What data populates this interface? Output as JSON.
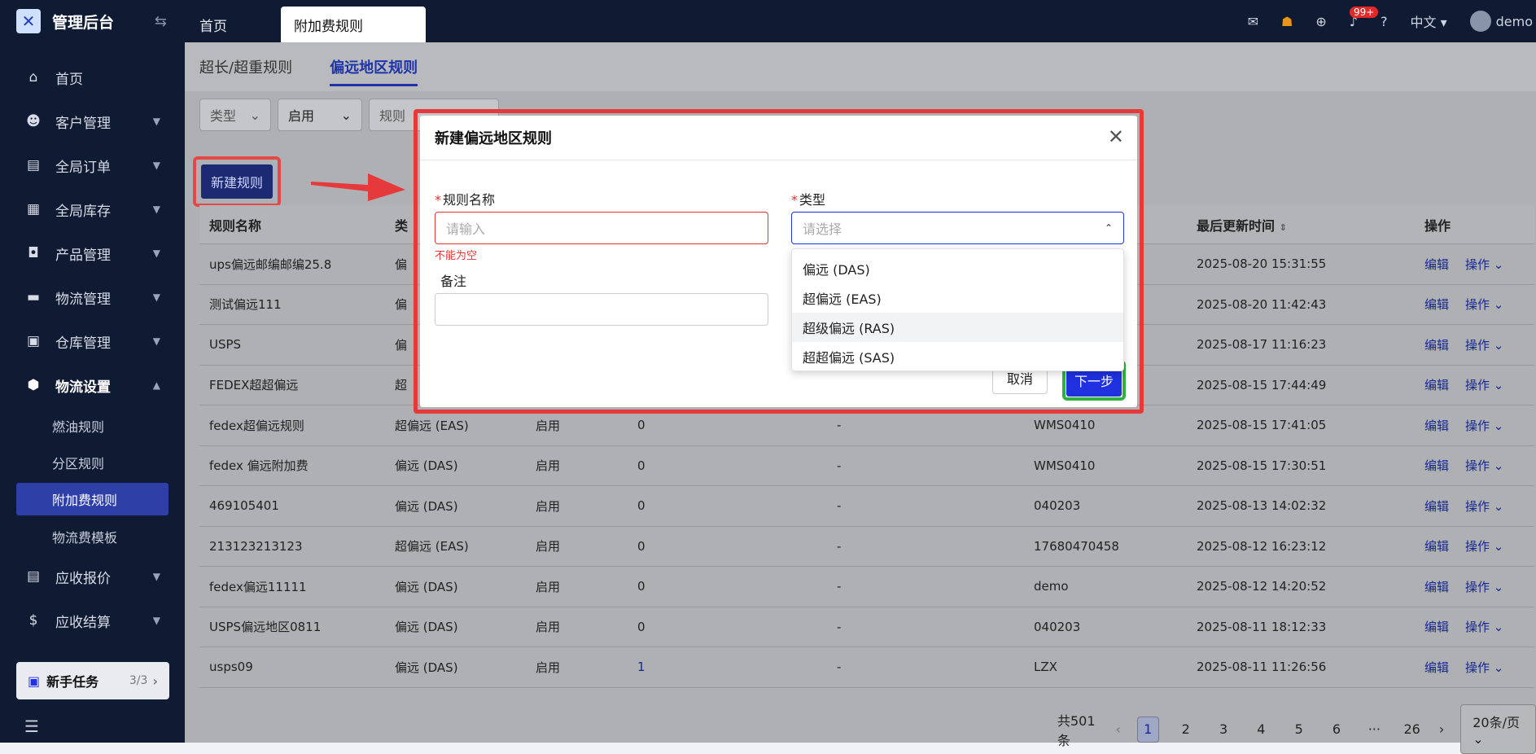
{
  "app": {
    "title": "管理后台"
  },
  "sidebar": {
    "items": [
      {
        "label": "首页"
      },
      {
        "label": "客户管理"
      },
      {
        "label": "全局订单"
      },
      {
        "label": "全局库存"
      },
      {
        "label": "产品管理"
      },
      {
        "label": "物流管理"
      },
      {
        "label": "仓库管理"
      },
      {
        "label": "物流设置"
      }
    ],
    "subitems": [
      {
        "label": "燃油规则"
      },
      {
        "label": "分区规则"
      },
      {
        "label": "附加费规则"
      },
      {
        "label": "物流费模板"
      }
    ],
    "items_after": [
      {
        "label": "应收报价"
      },
      {
        "label": "应收结算"
      }
    ],
    "task": {
      "label": "新手任务",
      "count": "3/3"
    }
  },
  "topbar": {
    "tabs": [
      {
        "label": "首页"
      },
      {
        "label": "附加费规则"
      }
    ],
    "badge": "99+",
    "lang": "中文",
    "user": "demo"
  },
  "subtabs": [
    {
      "label": "超长/超重规则"
    },
    {
      "label": "偏远地区规则"
    }
  ],
  "filters": {
    "type": "类型",
    "status": "启用",
    "name_placeholder": "规则"
  },
  "new_button": "新建规则",
  "table": {
    "headers": [
      "规则名称",
      "类",
      "",
      "",
      "",
      "",
      "最后更新时间",
      "操作"
    ],
    "rows": [
      [
        "ups偏远邮编邮编25.8",
        "偏",
        "",
        "",
        "",
        "",
        "2025-08-20 15:31:55"
      ],
      [
        "测试偏远111",
        "偏",
        "",
        "",
        "",
        "",
        "2025-08-20 11:42:43"
      ],
      [
        "USPS",
        "偏",
        "",
        "",
        "",
        "",
        "2025-08-17 11:16:23"
      ],
      [
        "FEDEX超超偏远",
        "超",
        "",
        "",
        "",
        "",
        "2025-08-15 17:44:49"
      ],
      [
        "fedex超偏远规则",
        "超偏远 (EAS)",
        "启用",
        "0",
        "-",
        "WMS0410",
        "2025-08-15 17:41:05"
      ],
      [
        "fedex 偏远附加费",
        "偏远 (DAS)",
        "启用",
        "0",
        "-",
        "WMS0410",
        "2025-08-15 17:30:51"
      ],
      [
        "469105401",
        "偏远 (DAS)",
        "启用",
        "0",
        "-",
        "040203",
        "2025-08-13 14:02:32"
      ],
      [
        "213123213123",
        "超偏远 (EAS)",
        "启用",
        "0",
        "-",
        "17680470458",
        "2025-08-12 16:23:12"
      ],
      [
        "fedex偏远11111",
        "偏远 (DAS)",
        "启用",
        "0",
        "-",
        "demo",
        "2025-08-12 14:20:52"
      ],
      [
        "USPS偏远地区0811",
        "偏远 (DAS)",
        "启用",
        "0",
        "-",
        "040203",
        "2025-08-11 18:12:33"
      ],
      [
        "usps09",
        "偏远 (DAS)",
        "启用",
        "1",
        "-",
        "LZX",
        "2025-08-11 11:26:56"
      ]
    ],
    "edit": "编辑",
    "ops": "操作"
  },
  "pager": {
    "total": "共501条",
    "pages": [
      "1",
      "2",
      "3",
      "4",
      "5",
      "6",
      "···",
      "26"
    ],
    "size": "20条/页"
  },
  "modal": {
    "title": "新建偏远地区规则",
    "name_label": "规则名称",
    "name_placeholder": "请输入",
    "name_error": "不能为空",
    "type_label": "类型",
    "type_placeholder": "请选择",
    "remark_label": "备注",
    "cancel": "取消",
    "next": "下一步",
    "options": [
      "偏远 (DAS)",
      "超偏远 (EAS)",
      "超级偏远 (RAS)",
      "超超偏远 (SAS)"
    ]
  },
  "colors": {
    "sidebar": "#0f1a33",
    "primary": "#1f31e0",
    "highlight_red": "#e5393c",
    "highlight_green": "#2eb23e"
  }
}
